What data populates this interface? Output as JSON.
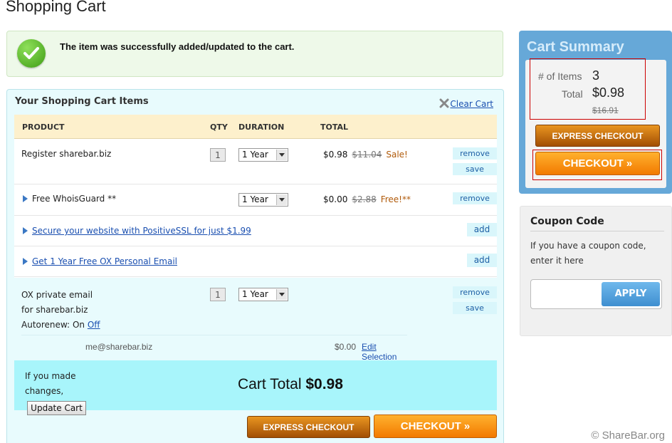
{
  "page": {
    "title": "Shopping Cart"
  },
  "notice": {
    "message": "The item was successfully added/updated to the cart.",
    "icon": "check-icon"
  },
  "cart": {
    "heading": "Your Shopping Cart Items",
    "clear_label": "Clear Cart",
    "columns": {
      "product": "PRODUCT",
      "qty": "QTY",
      "duration": "DURATION",
      "total": "TOTAL"
    },
    "items": [
      {
        "name": "Register sharebar.biz",
        "qty": "1",
        "duration": "1 Year",
        "price": "$0.98",
        "old_price": "$11.04",
        "note": "Sale!",
        "remove": "remove",
        "save": "save"
      },
      {
        "name": "Free WhoisGuard **",
        "duration": "1 Year",
        "price": "$0.00",
        "old_price": "$2.88",
        "note": "Free!**",
        "remove": "remove"
      },
      {
        "name": "Secure your website with PositiveSSL for just $1.99",
        "add": "add"
      },
      {
        "name": "Get 1 Year Free OX Personal Email",
        "add": "add"
      }
    ],
    "ox": {
      "line1": "OX private email",
      "line2": "for sharebar.biz",
      "autorenew_label": "Autorenew:",
      "autorenew_on": "On",
      "autorenew_off": "Off",
      "qty": "1",
      "duration": "1 Year",
      "remove": "remove",
      "save": "save",
      "email": "me@sharebar.biz",
      "email_price": "$0.00",
      "edit": "Edit Selection"
    },
    "footer": {
      "changes_line1": "If you made",
      "changes_line2": "changes,",
      "update_label": "Update Cart",
      "total_label": "Cart Total",
      "total_value": "$0.98",
      "express_label": "EXPRESS CHECKOUT",
      "checkout_label": "CHECKOUT »"
    }
  },
  "summary": {
    "title": "Cart Summary",
    "items_label": "# of Items",
    "items_value": "3",
    "total_label": "Total",
    "total_value": "$0.98",
    "old_total": "$16.91",
    "express_label": "EXPRESS CHECKOUT",
    "checkout_label": "CHECKOUT »"
  },
  "coupon": {
    "title": "Coupon Code",
    "text_line1": "If you have a coupon code,",
    "text_line2": "enter it here",
    "input_value": "",
    "apply_label": "APPLY"
  },
  "watermark": "© ShareBar.org",
  "colors": {
    "success_bg": "#eef9e9",
    "cart_bg": "#e8fbfd",
    "header_bg": "#fdf0cc",
    "total_bar": "#a8f5fb",
    "summary_bg": "#66a8d8",
    "orange": "#f27a00",
    "link": "#1a4fb0"
  }
}
